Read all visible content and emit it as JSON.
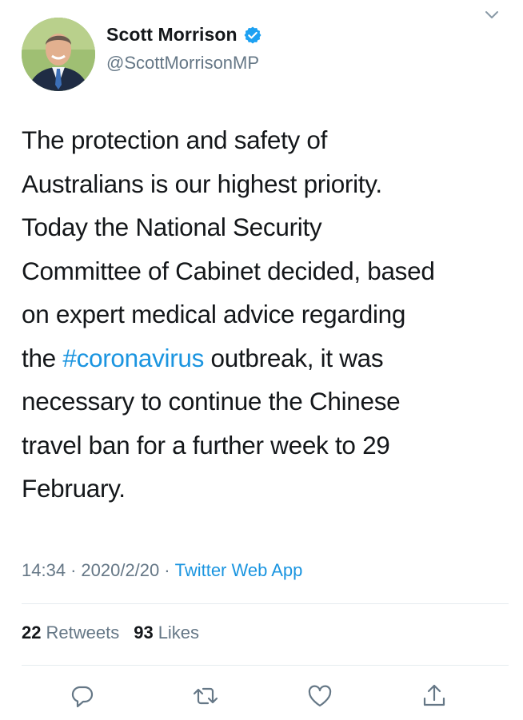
{
  "author": {
    "display_name": "Scott Morrison",
    "handle": "@ScottMorrisonMP",
    "verified": true
  },
  "tweet": {
    "text_lines": [
      "The protection and safety of",
      "Australians is our highest priority.",
      "Today the National Security",
      "Committee of Cabinet decided, based",
      "on expert medical advice regarding"
    ],
    "hashtag_line_prefix": "the ",
    "hashtag": "#coronavirus",
    "hashtag_line_suffix": " outbreak, it was",
    "text_lines_after": [
      "necessary to continue the Chinese",
      "travel ban for a further week to 29",
      "February."
    ]
  },
  "meta": {
    "time": "14:34",
    "date": "2020/2/20",
    "separator": "·",
    "source": "Twitter Web App"
  },
  "stats": {
    "retweets_count": "22",
    "retweets_label": "Retweets",
    "likes_count": "93",
    "likes_label": "Likes"
  },
  "icons": {
    "caret": "chevron-down-icon",
    "verified": "verified-badge-icon",
    "reply": "reply-icon",
    "retweet": "retweet-icon",
    "like": "heart-icon",
    "share": "share-icon"
  },
  "colors": {
    "link": "#1b95e0",
    "secondary_text": "#657786",
    "primary_text": "#14171a",
    "divider": "#e6ecf0"
  }
}
